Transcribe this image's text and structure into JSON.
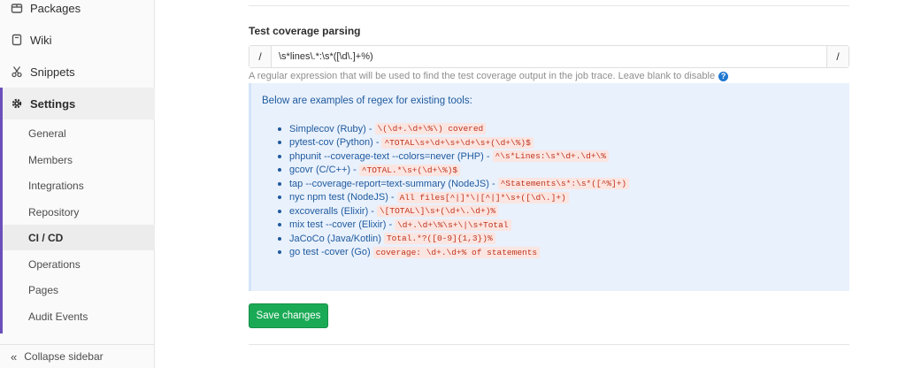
{
  "sidebar": {
    "top_items": [
      {
        "label": "Packages",
        "icon": "package-icon"
      },
      {
        "label": "Wiki",
        "icon": "book-icon"
      },
      {
        "label": "Snippets",
        "icon": "scissors-icon"
      },
      {
        "label": "Settings",
        "icon": "gear-icon"
      }
    ],
    "sub_items": [
      {
        "label": "General"
      },
      {
        "label": "Members"
      },
      {
        "label": "Integrations"
      },
      {
        "label": "Repository"
      },
      {
        "label": "CI / CD",
        "active": true
      },
      {
        "label": "Operations"
      },
      {
        "label": "Pages"
      },
      {
        "label": "Audit Events"
      }
    ],
    "collapse_label": "Collapse sidebar",
    "accent_color": "#6b4fbb"
  },
  "form": {
    "label": "Test coverage parsing",
    "prefix": "/",
    "suffix": "/",
    "value": "\\s*lines\\.*:\\s*([\\d\\.]+%)",
    "help": "A regular expression that will be used to find the test coverage output in the job trace. Leave blank to disable",
    "help_icon": "question-circle-icon"
  },
  "examples": {
    "title": "Below are examples of regex for existing tools:",
    "items": [
      {
        "tool": "Simplecov (Ruby) -",
        "regex": "\\(\\d+.\\d+\\%\\) covered"
      },
      {
        "tool": "pytest-cov (Python) -",
        "regex": "^TOTAL\\s+\\d+\\s+\\d+\\s+(\\d+\\%)$"
      },
      {
        "tool": "phpunit --coverage-text --colors=never (PHP) -",
        "regex": "^\\s*Lines:\\s*\\d+.\\d+\\%"
      },
      {
        "tool": "gcovr (C/C++) -",
        "regex": "^TOTAL.*\\s+(\\d+\\%)$"
      },
      {
        "tool": "tap --coverage-report=text-summary (NodeJS) -",
        "regex": "^Statements\\s*:\\s*([^%]+)"
      },
      {
        "tool": "nyc npm test (NodeJS) -",
        "regex": "All files[^|]*\\|[^|]*\\s+([\\d\\.]+)"
      },
      {
        "tool": "excoveralls (Elixir) -",
        "regex": "\\[TOTAL\\]\\s+(\\d+\\.\\d+)%"
      },
      {
        "tool": "mix test --cover (Elixir) -",
        "regex": "\\d+.\\d+\\%\\s+\\|\\s+Total"
      },
      {
        "tool": "JaCoCo (Java/Kotlin)",
        "regex": "Total.*?([0-9]{1,3})%"
      },
      {
        "tool": "go test -cover (Go)",
        "regex": "coverage: \\d+.\\d+% of statements"
      }
    ]
  },
  "actions": {
    "save_label": "Save changes",
    "save_color": "#1aaa55"
  }
}
